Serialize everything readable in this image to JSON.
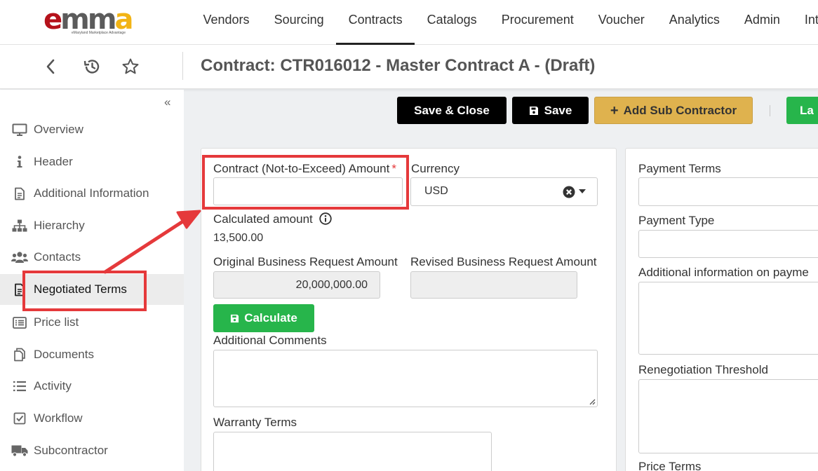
{
  "logo": {
    "part_e": "e",
    "part_mm": "mm",
    "part_a": "a",
    "tagline": "eMaryland Marketplace Advantage"
  },
  "nav": [
    {
      "label": "Vendors"
    },
    {
      "label": "Sourcing"
    },
    {
      "label": "Contracts"
    },
    {
      "label": "Catalogs"
    },
    {
      "label": "Procurement"
    },
    {
      "label": "Voucher"
    },
    {
      "label": "Analytics"
    },
    {
      "label": "Admin"
    },
    {
      "label": "Integr"
    }
  ],
  "nav_active": "Contracts",
  "page_title": "Contract: CTR016012 - Master Contract A - (Draft)",
  "sidebar": {
    "collapse_glyph": "«",
    "items": [
      {
        "label": "Overview",
        "icon": "monitor-icon"
      },
      {
        "label": "Header",
        "icon": "info-icon"
      },
      {
        "label": "Additional Information",
        "icon": "document-icon"
      },
      {
        "label": "Hierarchy",
        "icon": "sitemap-icon"
      },
      {
        "label": "Contacts",
        "icon": "users-icon"
      },
      {
        "label": "Negotiated Terms",
        "icon": "document-icon"
      },
      {
        "label": "Price list",
        "icon": "list-icon"
      },
      {
        "label": "Documents",
        "icon": "copy-icon"
      },
      {
        "label": "Activity",
        "icon": "list-icon"
      },
      {
        "label": "Workflow",
        "icon": "checkbox-icon"
      },
      {
        "label": "Subcontractor",
        "icon": "truck-icon"
      }
    ],
    "active": "Negotiated Terms"
  },
  "toolbar": {
    "save_close": "Save & Close",
    "save": "Save",
    "add_sub": "Add Sub Contractor",
    "launch_partial": "La"
  },
  "form": {
    "nte_label": "Contract (Not-to-Exceed) Amount",
    "required_mark": "*",
    "nte_value": "",
    "currency_label": "Currency",
    "currency_value": "USD",
    "calculated_label": "Calculated amount",
    "calculated_value": "13,500.00",
    "orig_label": "Original Business Request Amount",
    "orig_value": "20,000,000.00",
    "revised_label": "Revised Business Request Amount",
    "revised_value": "",
    "calculate_button": "Calculate",
    "comments_label": "Additional Comments",
    "warranty_label": "Warranty Terms"
  },
  "right_panel": {
    "payment_terms_label": "Payment Terms",
    "payment_type_label": "Payment Type",
    "additional_payment_label": "Additional information on payme",
    "renegotiation_label": "Renegotiation Threshold",
    "price_terms_label": "Price Terms"
  },
  "colors": {
    "accent_green": "#27b54b",
    "gold": "#dfb24e",
    "highlight_red": "#e5393b",
    "dark": "#000000"
  }
}
